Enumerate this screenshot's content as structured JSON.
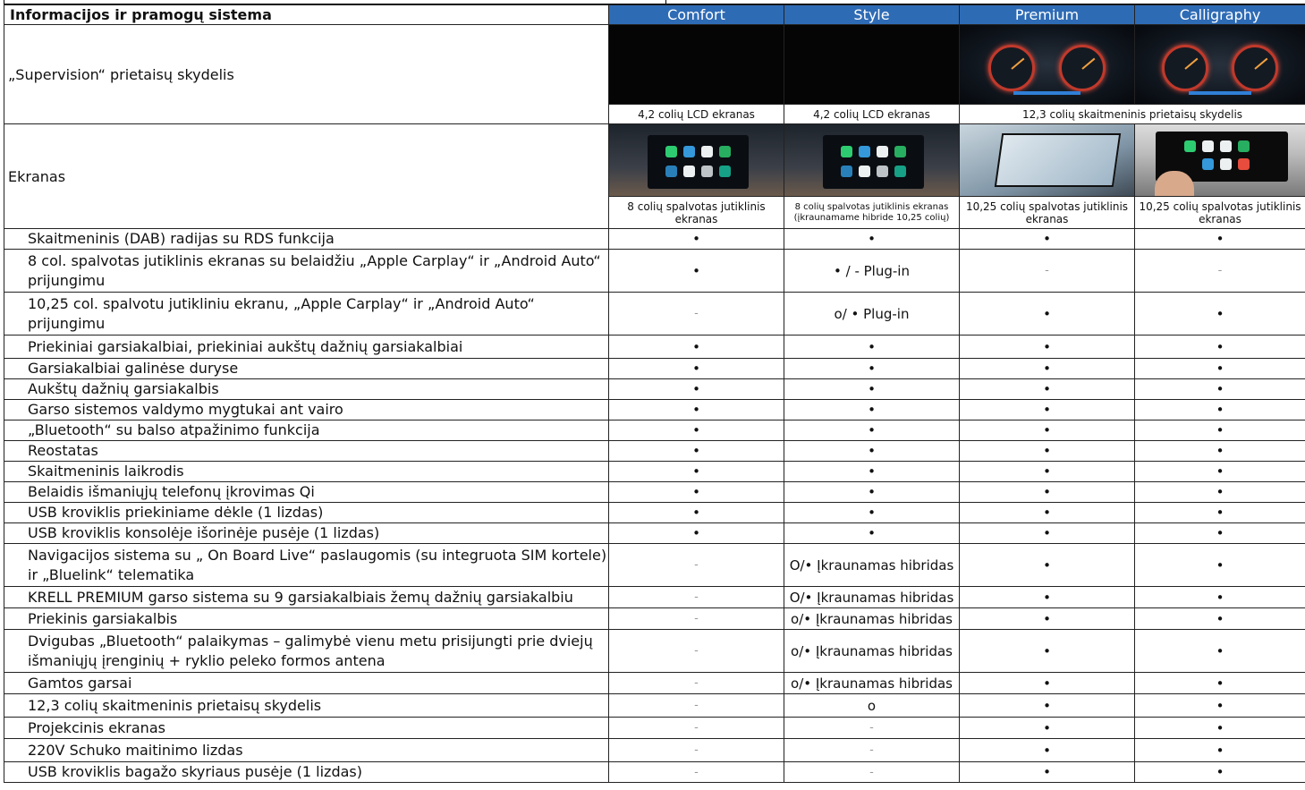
{
  "header": {
    "title": "Informacijos ir pramogų sistema",
    "trims": [
      "Comfort",
      "Style",
      "Premium",
      "Calligraphy"
    ],
    "accent_color": "#2e6bb5"
  },
  "supervision": {
    "label": "„Supervision“ prietaisų skydelis",
    "captions": {
      "comfort": "4,2 colių LCD ekranas",
      "style": "4,2 colių LCD ekranas",
      "premium_calligraphy": "12,3 colių skaitmeninis prietaisų skydelis"
    }
  },
  "ekranas": {
    "label": "Ekranas",
    "captions": {
      "comfort": "8 colių spalvotas jutiklinis ekranas",
      "style": "8 colių spalvotas jutiklinis ekranas (įkraunamame hibride 10,25 colių)",
      "premium": "10,25 colių spalvotas jutiklinis ekranas",
      "calligraphy": "10,25 colių spalvotas jutiklinis ekranas"
    }
  },
  "features": [
    {
      "name": "Skaitmeninis (DAB) radijas su RDS funkcija",
      "values": [
        "•",
        "•",
        "•",
        "•"
      ]
    },
    {
      "name": "8 col. spalvotas jutiklinis ekranas su belaidžiu „Apple Carplay“ ir „Android Auto“ prijungimu",
      "values": [
        "•",
        "• / - Plug-in",
        "-",
        "-"
      ]
    },
    {
      "name": "10,25 col. spalvotu jutikliniu ekranu, „Apple Carplay“ ir „Android Auto“ prijungimu",
      "values": [
        "-",
        "o/ • Plug-in",
        "•",
        "•"
      ]
    },
    {
      "name": "Priekiniai garsiakalbiai, priekiniai aukštų dažnių garsiakalbiai",
      "values": [
        "•",
        "•",
        "•",
        "•"
      ]
    },
    {
      "name": "Garsiakalbiai galinėse duryse",
      "values": [
        "•",
        "•",
        "•",
        "•"
      ]
    },
    {
      "name": "Aukštų dažnių garsiakalbis",
      "values": [
        "•",
        "•",
        "•",
        "•"
      ]
    },
    {
      "name": "Garso sistemos valdymo mygtukai ant vairo",
      "values": [
        "•",
        "•",
        "•",
        "•"
      ]
    },
    {
      "name": "„Bluetooth“ su balso atpažinimo funkcija",
      "values": [
        "•",
        "•",
        "•",
        "•"
      ]
    },
    {
      "name": "Reostatas",
      "values": [
        "•",
        "•",
        "•",
        "•"
      ]
    },
    {
      "name": "Skaitmeninis laikrodis",
      "values": [
        "•",
        "•",
        "•",
        "•"
      ]
    },
    {
      "name": "Belaidis išmaniųjų telefonų įkrovimas Qi",
      "values": [
        "•",
        "•",
        "•",
        "•"
      ]
    },
    {
      "name": "USB kroviklis priekiniame dėkle (1 lizdas)",
      "values": [
        "•",
        "•",
        "•",
        "•"
      ]
    },
    {
      "name": "USB kroviklis konsolėje išorinėje pusėje (1 lizdas)",
      "values": [
        "•",
        "•",
        "•",
        "•"
      ]
    },
    {
      "name": "Navigacijos sistema su „ On Board Live“ paslaugomis (su integruota SIM kortele) ir „Bluelink“ telematika",
      "values": [
        "-",
        "O/• Įkraunamas hibridas",
        "•",
        "•"
      ]
    },
    {
      "name": "KRELL PREMIUM garso sistema su 9 garsiakalbiais žemų dažnių garsiakalbiu",
      "values": [
        "-",
        "O/• Įkraunamas hibridas",
        "•",
        "•"
      ]
    },
    {
      "name": "Priekinis garsiakalbis",
      "values": [
        "-",
        "o/• Įkraunamas hibridas",
        "•",
        "•"
      ]
    },
    {
      "name": "Dvigubas „Bluetooth“ palaikymas – galimybė vienu metu prisijungti prie dviejų išmaniųjų įrenginių + ryklio peleko formos antena",
      "values": [
        "-",
        "o/• Įkraunamas hibridas",
        "•",
        "•"
      ]
    },
    {
      "name": "Gamtos garsai",
      "values": [
        "-",
        "o/• Įkraunamas hibridas",
        "•",
        "•"
      ]
    },
    {
      "name": "12,3 colių skaitmeninis prietaisų skydelis",
      "values": [
        "-",
        "o",
        "•",
        "•"
      ]
    },
    {
      "name": "Projekcinis ekranas",
      "values": [
        "-",
        "-",
        "•",
        "•"
      ]
    },
    {
      "name": "220V Schuko maitinimo lizdas",
      "values": [
        "-",
        "-",
        "•",
        "•"
      ]
    },
    {
      "name": "USB kroviklis bagažo skyriaus pusėje (1 lizdas)",
      "values": [
        "-",
        "-",
        "•",
        "•"
      ]
    }
  ]
}
